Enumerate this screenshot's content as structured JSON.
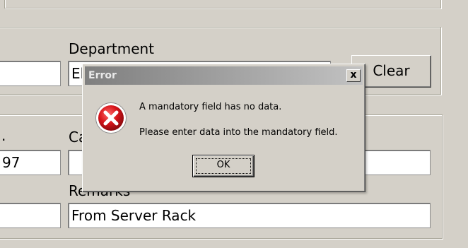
{
  "form": {
    "department_label": "Department",
    "department_value": "El",
    "clear_button": "Clear",
    "left_top_value": "",
    "left_mid_label": ".",
    "left_mid_value": "97",
    "left_bottom_value": "",
    "category_label": "Ca",
    "category_value": "",
    "remarks_label": "Remarks",
    "remarks_value": "From Server Rack"
  },
  "dialog": {
    "title": "Error",
    "close_glyph": "x",
    "icon": "error-x-icon",
    "message_line1": "A mandatory field has no data.",
    "message_line2": "Please enter data into the mandatory field.",
    "ok_button": "OK"
  },
  "colors": {
    "face": "#d4d0c8",
    "error_icon_red": "#d7141a"
  }
}
